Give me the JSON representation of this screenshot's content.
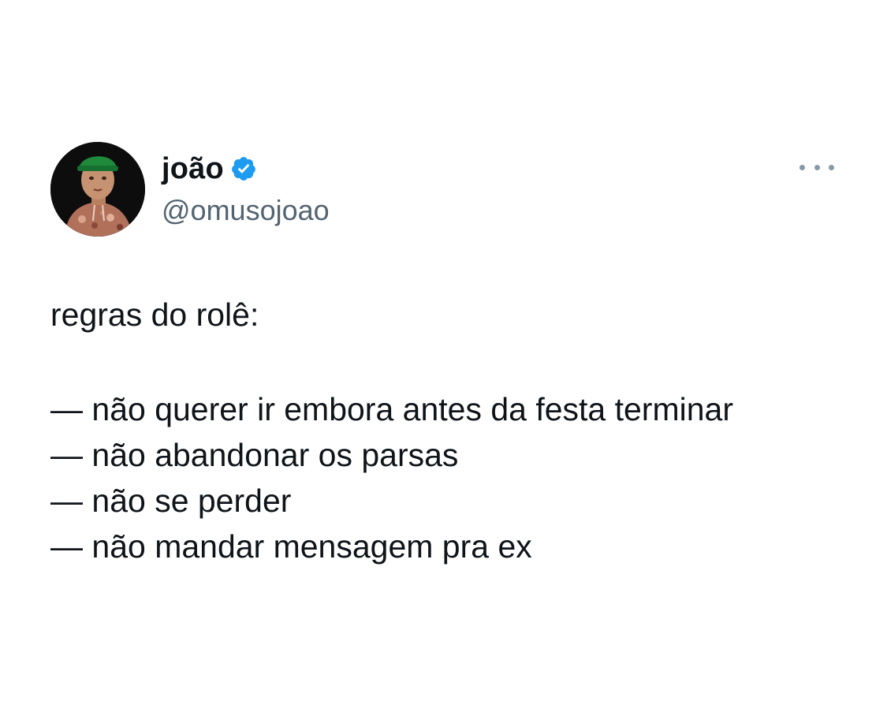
{
  "author": {
    "display_name": "joão",
    "handle": "@omusojoao",
    "verified": true,
    "verified_icon": "verified-badge-icon",
    "verified_color": "#1d9bf0"
  },
  "menu": {
    "icon": "more-options-icon"
  },
  "tweet": {
    "intro": "regras do rolê:",
    "rules": [
      "— não querer ir embora antes da festa terminar",
      "— não abandonar os parsas",
      "— não se perder",
      "— não mandar mensagem pra ex"
    ]
  }
}
